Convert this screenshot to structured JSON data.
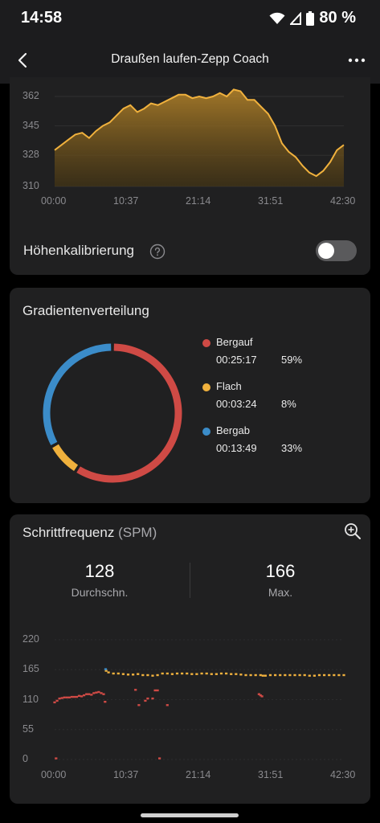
{
  "status_bar": {
    "time": "14:58",
    "battery_text": "80 %",
    "icons": [
      "wifi-icon",
      "signal-icon",
      "battery-icon"
    ]
  },
  "header": {
    "title": "Draußen laufen-Zepp Coach",
    "back_icon": "back-arrow-icon",
    "menu_icon": "more-dots-icon"
  },
  "elevation": {
    "calibration_label": "Höhenkalibrierung",
    "calibration_enabled": false
  },
  "gradient": {
    "title": "Gradientenverteilung",
    "items": [
      {
        "name": "Bergauf",
        "time": "00:25:17",
        "percent": "59%",
        "color": "#cf4a45"
      },
      {
        "name": "Flach",
        "time": "00:03:24",
        "percent": "8%",
        "color": "#f0b13d"
      },
      {
        "name": "Bergab",
        "time": "00:13:49",
        "percent": "33%",
        "color": "#3b8cc9"
      }
    ]
  },
  "cadence": {
    "title": "Schrittfrequenz",
    "unit": "(SPM)",
    "avg_value": "128",
    "avg_label": "Durchschn.",
    "max_value": "166",
    "max_label": "Max."
  },
  "chart_data": [
    {
      "type": "area",
      "x_ticks": [
        "00:00",
        "10:37",
        "21:14",
        "31:51",
        "42:30"
      ],
      "y_ticks": [
        "362",
        "345",
        "328",
        "310"
      ],
      "ylim": [
        310,
        362
      ],
      "series": [
        {
          "color": "#f0b13d",
          "x": [
            0,
            1,
            2,
            3,
            4,
            5,
            6,
            7,
            8,
            9,
            10,
            11,
            12,
            13,
            14,
            15,
            16,
            17,
            18,
            19,
            20,
            21,
            22,
            23,
            24,
            25,
            26,
            27,
            28,
            29,
            30,
            31,
            32,
            33,
            34,
            35,
            36,
            37,
            38,
            39,
            40,
            41,
            42
          ],
          "values": [
            331,
            334,
            337,
            340,
            341,
            338,
            342,
            345,
            347,
            351,
            355,
            357,
            353,
            355,
            358,
            357,
            359,
            361,
            363,
            363,
            361,
            362,
            361,
            362,
            364,
            362,
            366,
            365,
            360,
            360,
            356,
            352,
            345,
            335,
            330,
            327,
            322,
            318,
            316,
            319,
            324,
            331,
            334
          ]
        }
      ]
    },
    {
      "type": "pie",
      "labels": [
        "Bergauf",
        "Flach",
        "Bergab"
      ],
      "values": [
        59,
        8,
        33
      ],
      "colors": [
        "#cf4a45",
        "#f0b13d",
        "#3b8cc9"
      ]
    },
    {
      "type": "scatter",
      "x_ticks": [
        "00:00",
        "10:37",
        "21:14",
        "31:51",
        "42:30"
      ],
      "y_ticks": [
        "220",
        "165",
        "110",
        "55",
        "0"
      ],
      "ylim": [
        0,
        220
      ],
      "series": [
        {
          "color": "#f0b13d",
          "x": [
            10.5,
            11,
            12,
            13,
            14,
            15,
            16,
            17,
            18,
            19,
            20,
            21,
            22,
            23,
            24,
            25,
            26,
            27,
            28,
            29,
            30,
            31,
            32,
            33,
            34,
            35,
            36,
            37,
            38,
            39,
            40,
            41,
            42,
            42.5,
            43,
            44,
            45,
            46,
            47,
            48,
            49,
            50,
            51,
            52,
            53,
            54,
            55,
            56,
            57,
            58,
            59
          ],
          "values": [
            163,
            160,
            158,
            158,
            157,
            156,
            156,
            157,
            155,
            155,
            154,
            155,
            158,
            158,
            157,
            158,
            158,
            158,
            157,
            157,
            158,
            158,
            157,
            157,
            158,
            158,
            157,
            157,
            156,
            155,
            155,
            155,
            155,
            154,
            154,
            155,
            155,
            155,
            155,
            155,
            155,
            155,
            155,
            154,
            154,
            155,
            155,
            155,
            155,
            155,
            155
          ]
        },
        {
          "color": "#cf4a45",
          "x": [
            0,
            0.5,
            1,
            1.5,
            2,
            2.5,
            3,
            3.5,
            4,
            4.5,
            5,
            5.5,
            6,
            6.5,
            7,
            7.5,
            8,
            8.5,
            9,
            9.5,
            10,
            10.3,
            16.5,
            17.2,
            18.5,
            19,
            20,
            20.5,
            21,
            23,
            41.7,
            42,
            42.3
          ],
          "values": [
            105,
            108,
            112,
            113,
            114,
            114,
            114,
            115,
            115,
            115,
            117,
            116,
            118,
            120,
            120,
            119,
            122,
            123,
            124,
            122,
            120,
            106,
            128,
            100,
            108,
            112,
            112,
            127,
            127,
            100,
            120,
            118,
            116
          ]
        },
        {
          "color": "#cf4a45",
          "x": [
            0.3,
            21.4
          ],
          "values": [
            2,
            2
          ]
        },
        {
          "color": "#3b8cc9",
          "x": [
            10.4
          ],
          "values": [
            166
          ]
        }
      ]
    }
  ]
}
